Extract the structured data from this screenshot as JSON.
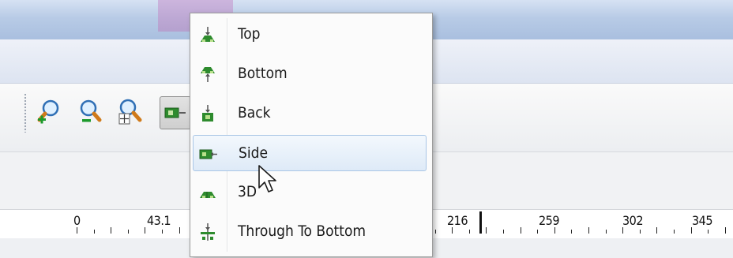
{
  "menu": {
    "items": [
      {
        "label": "Top",
        "icon": "view-top-icon"
      },
      {
        "label": "Bottom",
        "icon": "view-bottom-icon"
      },
      {
        "label": "Back",
        "icon": "view-back-icon"
      },
      {
        "label": "Side",
        "icon": "view-side-icon",
        "selected": true
      },
      {
        "label": "3D",
        "icon": "view-3d-icon"
      },
      {
        "label": "Through To Bottom",
        "icon": "view-through-to-bottom-icon"
      }
    ]
  },
  "toolbar": {
    "buttons": [
      {
        "name": "zoom-in",
        "icon": "zoom-in-icon"
      },
      {
        "name": "zoom-out",
        "icon": "zoom-out-icon"
      },
      {
        "name": "zoom-fit",
        "icon": "zoom-fit-icon"
      },
      {
        "name": "view-mode",
        "icon": "view-side-icon",
        "pressed": true
      }
    ]
  },
  "ruler": {
    "labels": [
      "0",
      "43.1",
      "216",
      "259",
      "302",
      "345"
    ]
  },
  "colors": {
    "selection_bg": "#deeaf7",
    "selection_border": "#a9c6e6",
    "icon_green": "#2e8b2e"
  }
}
